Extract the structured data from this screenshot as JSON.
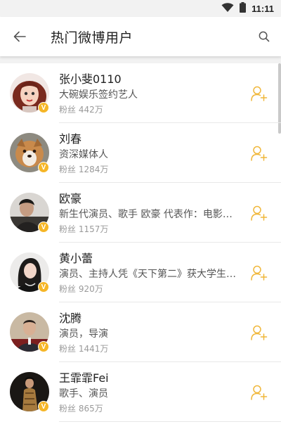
{
  "status": {
    "time": "11:11",
    "icons": [
      "wifi-icon",
      "battery-icon"
    ]
  },
  "header": {
    "title": "热门微博用户",
    "back_icon": "back-arrow-icon",
    "search_icon": "search-icon"
  },
  "colors": {
    "accent": "#f5b627",
    "follow_icon": "#f0b73a",
    "verified_badge": "#f5b627"
  },
  "users": [
    {
      "name": "张小斐0110",
      "desc": "大碗娱乐签约艺人",
      "fans": "粉丝 442万",
      "badge": "V"
    },
    {
      "name": "刘春",
      "desc": "资深媒体人",
      "fans": "粉丝 1284万",
      "badge": "V"
    },
    {
      "name": "欧豪",
      "desc": "新生代演员、歌手 欧豪 代表作：电影《…",
      "fans": "粉丝 1157万",
      "badge": "V"
    },
    {
      "name": "黄小蕾",
      "desc": "演员、主持人凭《天下第二》获大学生…",
      "fans": "粉丝 920万",
      "badge": "V"
    },
    {
      "name": "沈腾",
      "desc": "演员，导演",
      "fans": "粉丝 1441万",
      "badge": "V"
    },
    {
      "name": "王霏霏Fei",
      "desc": "歌手、演员",
      "fans": "粉丝 865万",
      "badge": "V"
    }
  ]
}
